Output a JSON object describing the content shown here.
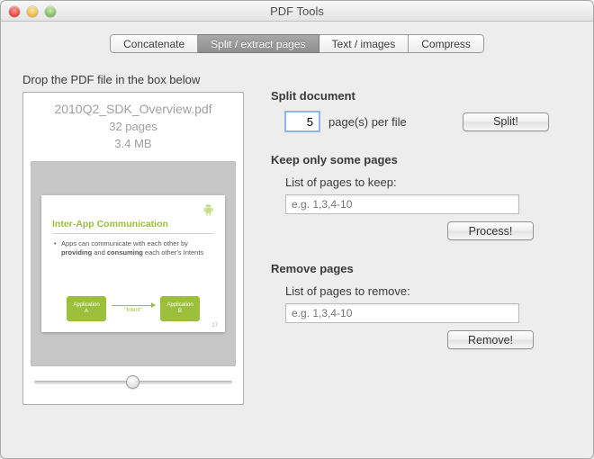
{
  "window": {
    "title": "PDF Tools"
  },
  "tabs": {
    "items": [
      {
        "label": "Concatenate"
      },
      {
        "label": "Split / extract pages"
      },
      {
        "label": "Text / images"
      },
      {
        "label": "Compress"
      }
    ]
  },
  "drop": {
    "label": "Drop the PDF file in the box below",
    "file": {
      "name": "2010Q2_SDK_Overview.pdf",
      "pages": "32 pages",
      "size": "3.4 MB"
    },
    "preview": {
      "slide_title": "Inter-App Communication",
      "bullet_html": "Apps can communicate with each other by providing and consuming each other's Intents",
      "box_a_line1": "Application",
      "box_a_line2": "A",
      "box_b_line1": "Application",
      "box_b_line2": "B",
      "arrow_label": "\"Intent\"",
      "page_no": "17"
    }
  },
  "split": {
    "heading": "Split document",
    "value": "5",
    "suffix": "page(s) per file",
    "button": "Split!"
  },
  "keep": {
    "heading": "Keep only some pages",
    "sublabel": "List of pages to keep:",
    "placeholder": "e.g. 1,3,4-10",
    "button": "Process!"
  },
  "remove": {
    "heading": "Remove pages",
    "sublabel": "List of pages to remove:",
    "placeholder": "e.g. 1,3,4-10",
    "button": "Remove!"
  }
}
